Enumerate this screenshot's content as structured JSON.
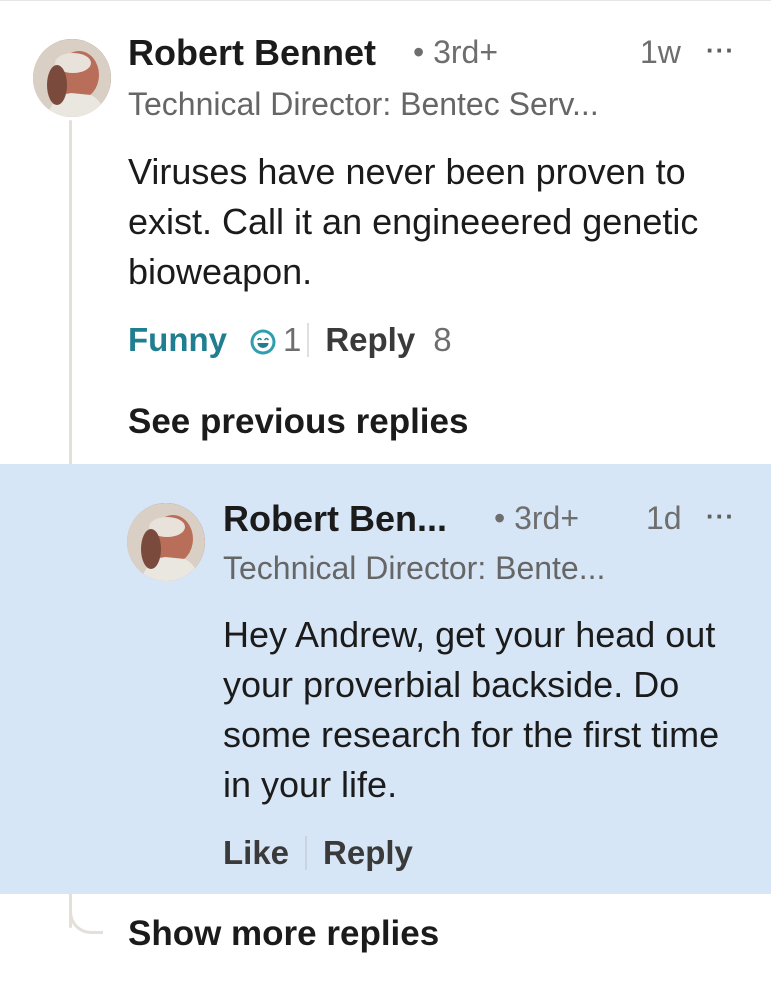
{
  "comment": {
    "author": "Robert Bennet",
    "degree": "• 3rd+",
    "time": "1w",
    "more_label": "···",
    "headline": "Technical Director: Bentec Serv...",
    "body": "Viruses have never been proven to exist. Call it an engineeered genetic bioweapon.",
    "reaction_label": "Funny",
    "reaction_icon": "laughing-face-icon",
    "reaction_count": "1",
    "reply_label": "Reply",
    "reply_count": "8"
  },
  "see_previous_replies": "See previous replies",
  "reply": {
    "author": "Robert Ben...",
    "degree": "• 3rd+",
    "time": "1d",
    "more_label": "···",
    "headline": "Technical Director: Bente...",
    "body": "Hey Andrew, get your head out your proverbial backside. Do some research for the first time in your life.",
    "like_label": "Like",
    "reply_label": "Reply"
  },
  "show_more_replies": "Show more replies",
  "colors": {
    "highlight_background": "#d7e6f6",
    "funny_accent": "#1f7e8f",
    "thread_line": "#e3e0d9"
  }
}
